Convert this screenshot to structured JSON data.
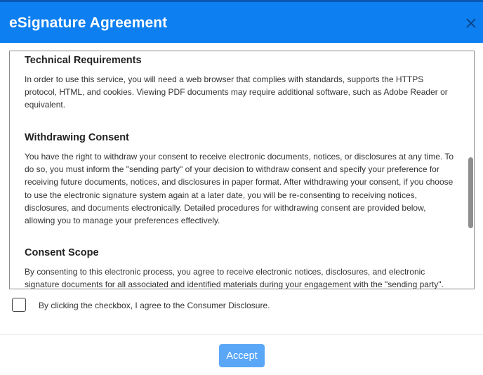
{
  "dialog": {
    "title": "eSignature Agreement"
  },
  "content": {
    "sections": [
      {
        "title": "Technical Requirements",
        "body": "In order to use this service, you will need a web browser that complies with standards, supports the HTTPS protocol, HTML, and cookies. Viewing PDF documents may require additional software, such as Adobe Reader or equivalent."
      },
      {
        "title": "Withdrawing Consent",
        "body": "You have the right to withdraw your consent to receive electronic documents, notices, or disclosures at any time. To do so, you must inform the \"sending party\" of your decision to withdraw consent and specify your preference for receiving future documents, notices, and disclosures in paper format. After withdrawing your consent, if you choose to use the electronic signature system again at a later date, you will be re-consenting to receiving notices, disclosures, and documents electronically. Detailed procedures for withdrawing consent are provided below, allowing you to manage your preferences effectively."
      },
      {
        "title": "Consent Scope",
        "body": "By consenting to this electronic process, you agree to receive electronic notices, disclosures, and electronic signature documents for all associated and identified materials during your engagement with the \"sending party\"."
      }
    ]
  },
  "agreement": {
    "checkbox_label": "By clicking the checkbox, I agree to the Consumer Disclosure."
  },
  "footer": {
    "accept_label": "Accept"
  },
  "colors": {
    "header_bg": "#0d7ff0",
    "accept_bg": "#5aa7f8"
  },
  "icons": {
    "close": "close-icon"
  }
}
